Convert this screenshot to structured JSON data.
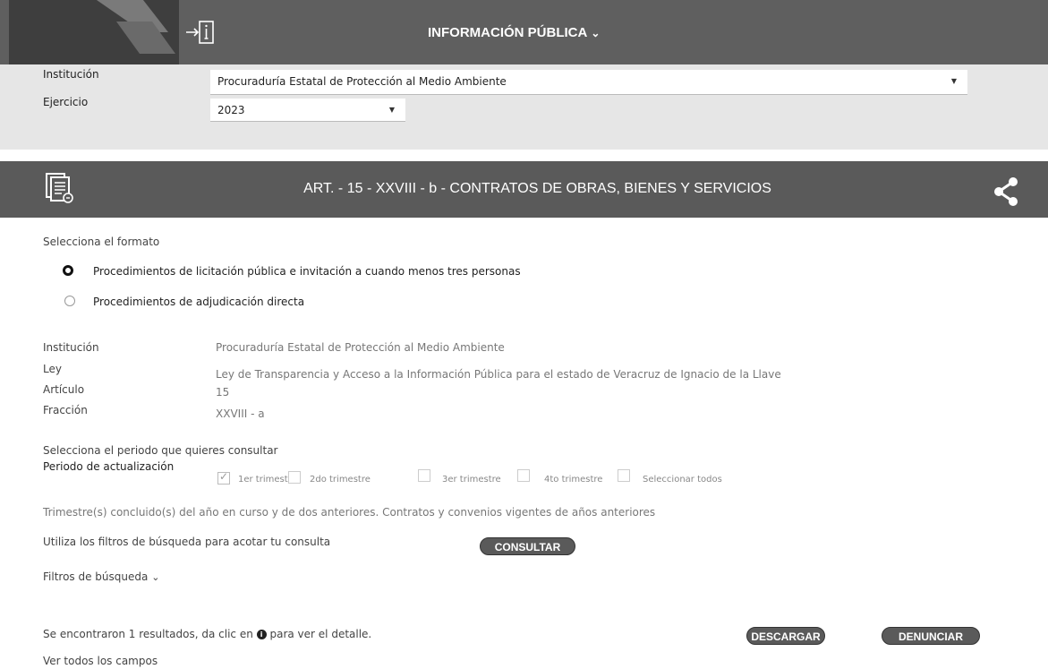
{
  "header": {
    "menu_label": "INFORMACIÓN PÚBLICA",
    "menu_icon": "chevron-down-icon",
    "login_icon": "login-icon"
  },
  "filters": {
    "institution_label": "Institución",
    "institution_value": "Procuraduría Estatal de Protección al Medio Ambiente",
    "year_label": "Ejercicio",
    "year_value": "2023"
  },
  "article": {
    "title": "ART. - 15 - XXVIII - b - CONTRATOS DE OBRAS, BIENES Y SERVICIOS",
    "icon": "document-icon",
    "share_icon": "share-icon"
  },
  "format": {
    "label": "Selecciona el formato",
    "options": [
      {
        "label": "Procedimientos de licitación pública e invitación a cuando menos tres personas",
        "selected": true
      },
      {
        "label": "Procedimientos de adjudicación directa",
        "selected": false
      }
    ]
  },
  "details": [
    {
      "label": "Institución",
      "value": "Procuraduría Estatal de Protección al Medio Ambiente"
    },
    {
      "label": "Ley",
      "value": "Ley de Transparencia y Acceso a la Información Pública para el estado de Veracruz de Ignacio de la Llave"
    },
    {
      "label": "Artículo",
      "value": "15"
    },
    {
      "label": "Fracción",
      "value": "XXVIII - a"
    }
  ],
  "period": {
    "prompt": "Selecciona el periodo que quieres consultar",
    "label": "Periodo de actualización",
    "options": [
      {
        "label": "1er trimestre",
        "checked": true
      },
      {
        "label": "2do trimestre",
        "checked": false
      },
      {
        "label": "3er trimestre",
        "checked": false
      },
      {
        "label": "4to trimestre",
        "checked": false
      },
      {
        "label": "Seleccionar todos",
        "checked": false
      }
    ],
    "note": "Trimestre(s) concluido(s) del año en curso y de dos anteriores. Contratos y convenios vigentes de años anteriores"
  },
  "search": {
    "hint": "Utiliza los filtros de búsqueda para acotar tu consulta",
    "consult_button": "CONSULTAR",
    "filters_label": "Filtros de búsqueda"
  },
  "results": {
    "text_before": "Se encontraron 1 resultados, da clic en",
    "text_after": "para ver el detalle.",
    "download_button": "DESCARGAR",
    "report_button": "DENUNCIAR",
    "view_all": "Ver todos los campos"
  }
}
